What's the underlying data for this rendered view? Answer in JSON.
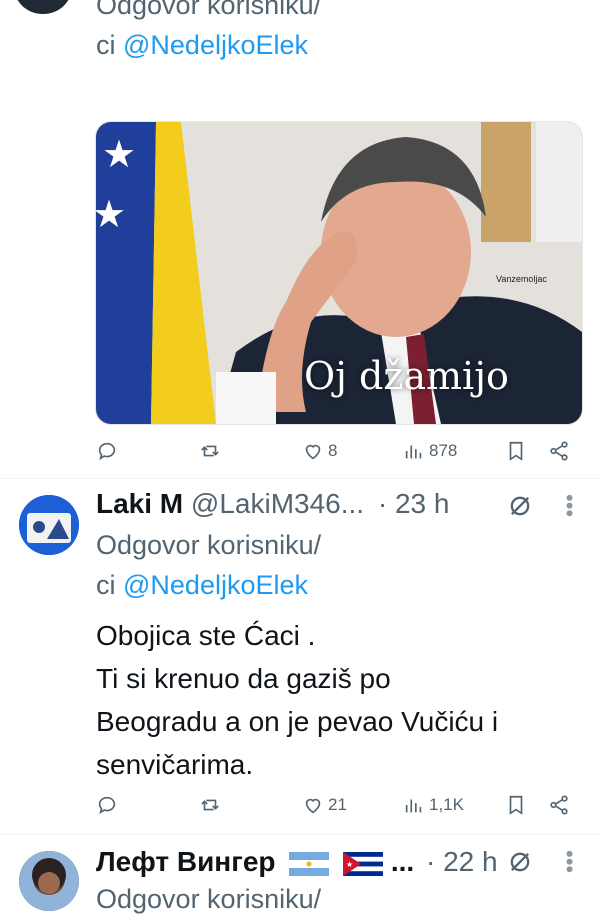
{
  "tweet1": {
    "reply_line1": "Odgovor korisniku/",
    "reply_line2_prefix": "ci ",
    "reply_handle": "@NedeljkoElek",
    "media": {
      "caption": "Oj džamijo",
      "watermark": "Vanzemoljac"
    },
    "stats": {
      "replies": "",
      "reposts": "",
      "likes": "8",
      "views": "878"
    }
  },
  "tweet2": {
    "name": "Laki M",
    "handle": "@LakiM346...",
    "time": "· 23 h",
    "reply_line1": "Odgovor korisniku/",
    "reply_line2_prefix": "ci ",
    "reply_handle": "@NedeljkoElek",
    "text_lines": [
      "Obojica ste Ćaci .",
      "Ti si krenuo da gaziš  po",
      "Beogradu  a on je pevao Vučiću i",
      "senvičarima."
    ],
    "stats": {
      "replies": "",
      "reposts": "",
      "likes": "21",
      "views": "1,1K"
    }
  },
  "tweet3": {
    "name": "Лефт Вингер",
    "ellipsis": "...",
    "time": "· 22 h",
    "reply_line1": "Odgovor korisniku/"
  },
  "colors": {
    "link": "#1d9bf0",
    "muted": "#536471",
    "divider": "#eff3f4"
  }
}
